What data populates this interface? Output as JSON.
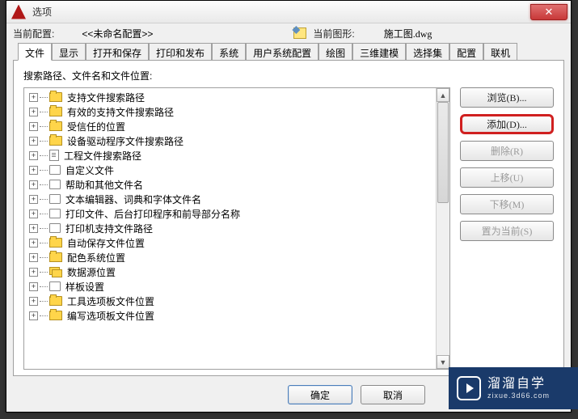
{
  "title": "选项",
  "close_glyph": "✕",
  "profile": {
    "label": "当前配置:",
    "value": "<<未命名配置>>"
  },
  "drawing": {
    "label": "当前图形:",
    "value": "施工图.dwg"
  },
  "tabs": [
    "文件",
    "显示",
    "打开和保存",
    "打印和发布",
    "系统",
    "用户系统配置",
    "绘图",
    "三维建模",
    "选择集",
    "配置",
    "联机"
  ],
  "active_tab": 0,
  "content_label": "搜索路径、文件名和文件位置:",
  "tree": [
    {
      "icon": "y",
      "label": "支持文件搜索路径"
    },
    {
      "icon": "y",
      "label": "有效的支持文件搜索路径"
    },
    {
      "icon": "y",
      "label": "受信任的位置"
    },
    {
      "icon": "y",
      "label": "设备驱动程序文件搜索路径"
    },
    {
      "icon": "p",
      "label": "工程文件搜索路径"
    },
    {
      "icon": "w",
      "label": "自定义文件"
    },
    {
      "icon": "w",
      "label": "帮助和其他文件名"
    },
    {
      "icon": "w",
      "label": "文本编辑器、词典和字体文件名"
    },
    {
      "icon": "w",
      "label": "打印文件、后台打印程序和前导部分名称"
    },
    {
      "icon": "w",
      "label": "打印机支持文件路径"
    },
    {
      "icon": "y",
      "label": "自动保存文件位置"
    },
    {
      "icon": "y",
      "label": "配色系统位置"
    },
    {
      "icon": "s",
      "label": "数据源位置"
    },
    {
      "icon": "w",
      "label": "样板设置"
    },
    {
      "icon": "y",
      "label": "工具选项板文件位置"
    },
    {
      "icon": "y",
      "label": "编写选项板文件位置"
    }
  ],
  "buttons": {
    "browse": "浏览(B)...",
    "add": "添加(D)...",
    "remove": "删除(R)",
    "up": "上移(U)",
    "down": "下移(M)",
    "set_current": "置为当前(S)"
  },
  "dialog_buttons": {
    "ok": "确定",
    "cancel": "取消"
  },
  "watermark": {
    "main": "溜溜自学",
    "sub": "zixue.3d66.com"
  },
  "scroll_up": "▲",
  "scroll_down": "▼"
}
